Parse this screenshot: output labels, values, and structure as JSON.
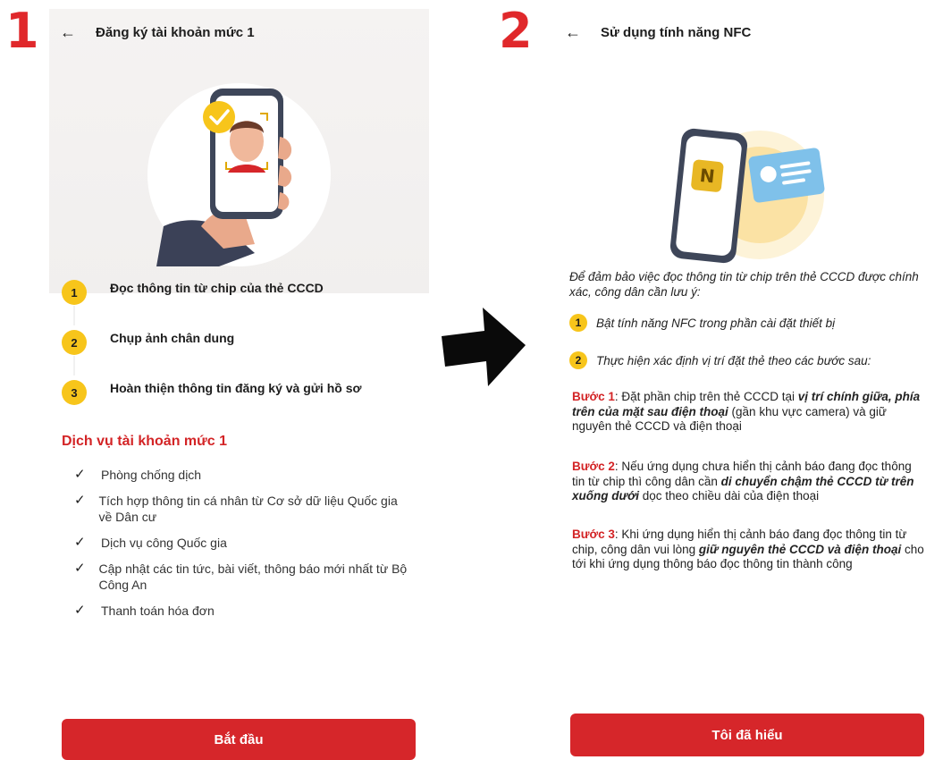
{
  "labels": {
    "one": "1",
    "two": "2"
  },
  "panel1": {
    "title": "Đăng ký tài khoản mức 1",
    "steps": [
      {
        "num": "1",
        "text": "Đọc thông tin từ chip của thẻ CCCD"
      },
      {
        "num": "2",
        "text": "Chụp ảnh chân dung"
      },
      {
        "num": "3",
        "text": "Hoàn thiện thông tin đăng ký và gửi hồ sơ"
      }
    ],
    "service_title": "Dịch vụ tài khoản mức 1",
    "services": [
      "Phòng chống dịch",
      "Tích hợp thông tin cá nhân từ Cơ sở dữ liệu Quốc gia về Dân cư",
      "Dịch vụ công Quốc gia",
      "Cập nhật các tin tức, bài viết, thông báo mới nhất từ Bộ Công An",
      "Thanh toán hóa đơn"
    ],
    "button": "Bắt đầu"
  },
  "panel2": {
    "title": "Sử dụng tính năng NFC",
    "intro": "Để đảm bảo việc đọc thông tin từ chip trên thẻ CCCD được chính xác, công dân cần lưu ý:",
    "steps": [
      {
        "num": "1",
        "text": "Bật tính năng NFC trong phần cài đặt thiết bị"
      },
      {
        "num": "2",
        "text": "Thực hiện xác định vị trí đặt thẻ theo các bước sau:"
      }
    ],
    "b1": {
      "label": "Bước 1",
      "t1": ": Đặt phần chip trên thẻ CCCD tại ",
      "bold": "vị trí chính giữa, phía trên của mặt sau điện thoại",
      "t2": " (gần khu vực camera) và giữ nguyên thẻ CCCD và điện thoại"
    },
    "b2": {
      "label": "Bước 2",
      "t1": ": Nếu ứng dụng chưa hiển thị cảnh báo đang đọc thông tin từ chip thì công dân cần ",
      "bold": "di chuyển chậm thẻ CCCD từ trên xuống dưới",
      "t2": " dọc theo chiều dài của điện thoại"
    },
    "b3": {
      "label": "Bước 3",
      "t1": ": Khi ứng dụng hiển thị cảnh báo đang đọc thông tin từ chip, công dân vui lòng ",
      "bold": "giữ nguyên thẻ CCCD và điện thoại",
      "t2": " cho tới khi ứng dụng thông báo đọc thông tin thành công"
    },
    "button": "Tôi đã hiểu"
  },
  "colors": {
    "accent": "#d6262a",
    "badge": "#f7c51b",
    "nfc_badge": "#e8b724"
  }
}
